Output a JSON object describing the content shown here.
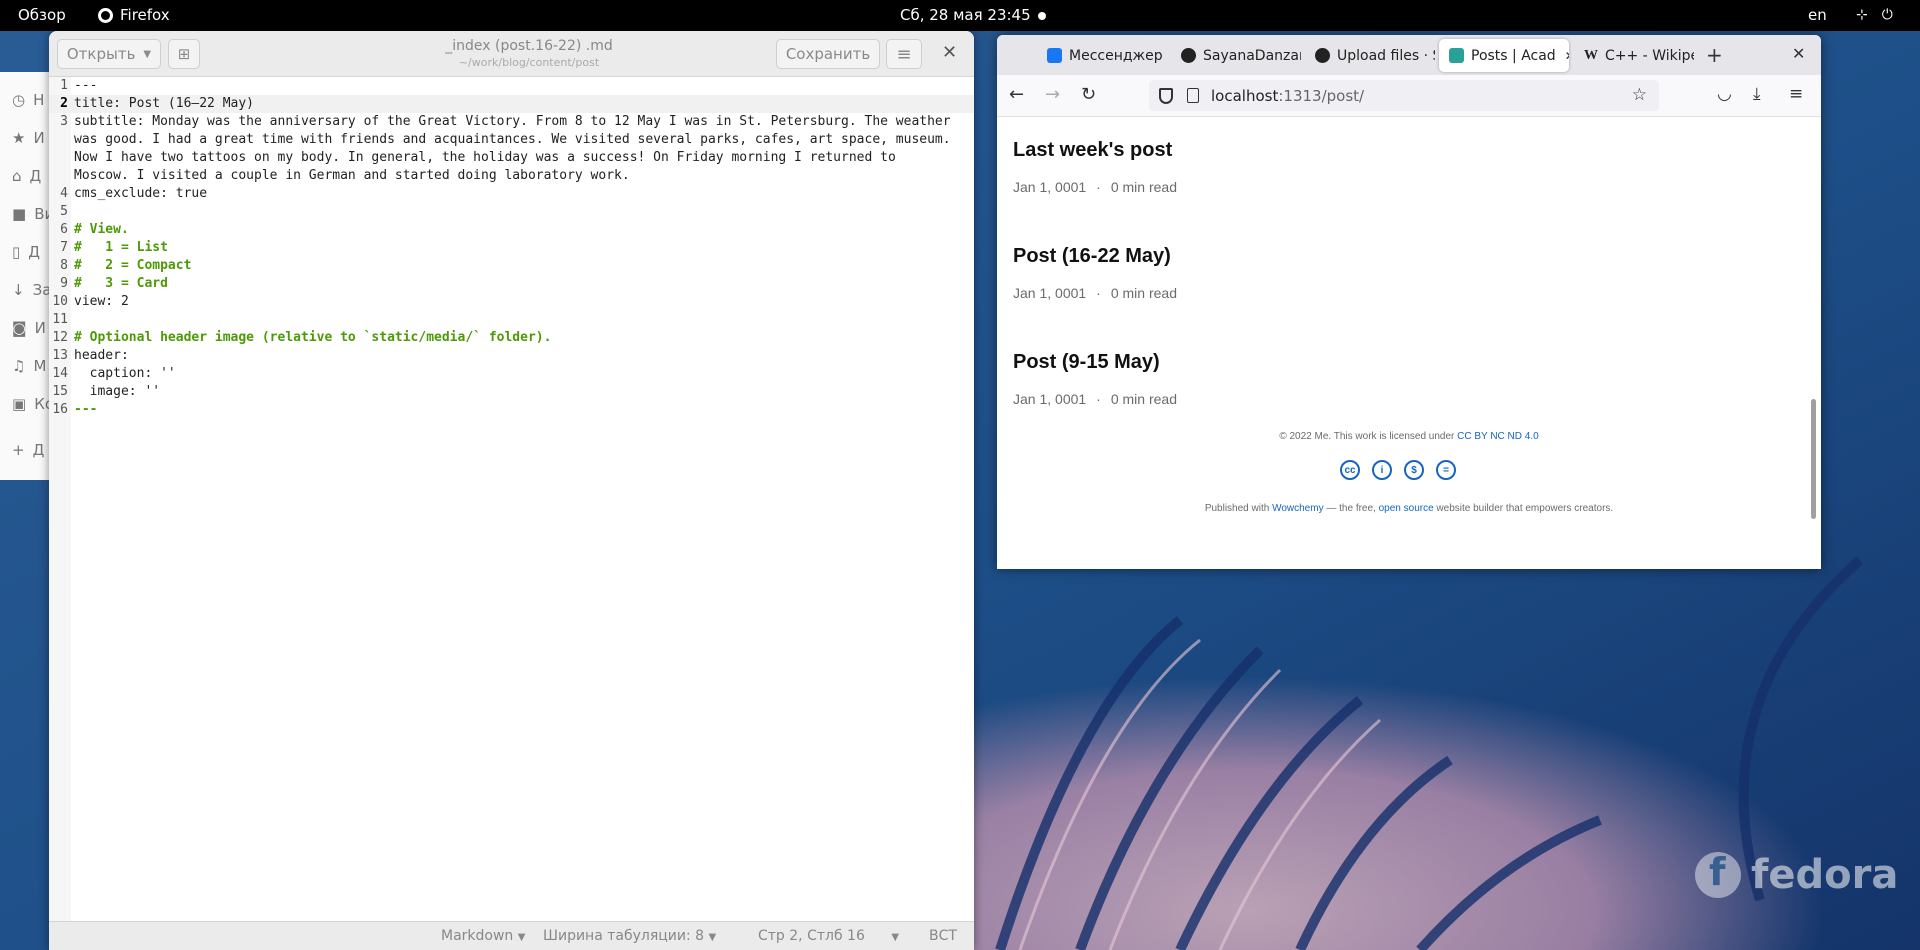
{
  "topbar": {
    "activities": "Обзор",
    "app": "Firefox",
    "clock": "Сб, 28 мая  23:45",
    "lang": "en"
  },
  "background_window": {
    "items": [
      "Н",
      "И",
      "Д",
      "Ви",
      "Д",
      "За",
      "И",
      "М",
      "Ко",
      "Д"
    ]
  },
  "editor": {
    "open_label": "Открыть",
    "title": "_index (post.16-22) .md",
    "subtitle": "~/work/blog/content/post",
    "save_label": "Сохранить",
    "lines": [
      {
        "n": "1",
        "text": "---"
      },
      {
        "n": "2",
        "text": "title: Post (16–22 May)"
      },
      {
        "n": "3",
        "text": "subtitle: Monday was the anniversary of the Great Victory. From 8 to 12 May I was in St. Petersburg. The weather"
      },
      {
        "n": "",
        "text": "was good. I had a great time with friends and acquaintances. We visited several parks, cafes, art space, museum."
      },
      {
        "n": "",
        "text": "Now I have two tattoos on my body. In general, the holiday was a success! On Friday morning I returned to"
      },
      {
        "n": "",
        "text": "Moscow. I visited a couple in German and started doing laboratory work."
      },
      {
        "n": "4",
        "text": "cms_exclude: true"
      },
      {
        "n": "5",
        "text": ""
      },
      {
        "n": "6",
        "text": "# View."
      },
      {
        "n": "7",
        "text": "#   1 = List"
      },
      {
        "n": "8",
        "text": "#   2 = Compact"
      },
      {
        "n": "9",
        "text": "#   3 = Card"
      },
      {
        "n": "10",
        "text": "view: 2"
      },
      {
        "n": "11",
        "text": ""
      },
      {
        "n": "12",
        "text": "# Optional header image (relative to `static/media/` folder)."
      },
      {
        "n": "13",
        "text": "header:"
      },
      {
        "n": "14",
        "text": "  caption: ''"
      },
      {
        "n": "15",
        "text": "  image: ''"
      },
      {
        "n": "16",
        "text": "---"
      }
    ],
    "status": {
      "language": "Markdown",
      "tab_width": "Ширина табуляции: 8",
      "position": "Стр 2, Стлб 16",
      "mode": "ВСТ"
    }
  },
  "browser": {
    "tabs": [
      {
        "label": "Мессенджер",
        "icon": "messenger-icon",
        "color": "#1877f2"
      },
      {
        "label": "SayanaDanzar",
        "icon": "github-icon",
        "color": "#222222"
      },
      {
        "label": "Upload files · S",
        "icon": "github-icon",
        "color": "#222222"
      },
      {
        "label": "Posts | Acad",
        "icon": "academic-icon",
        "color": "#2aa198"
      },
      {
        "label": "C++ - Wikiped",
        "icon": "wikipedia-icon",
        "color": "#222222"
      }
    ],
    "url_host": "localhost",
    "url_path": ":1313/post/",
    "posts": [
      {
        "title": "Last week's post",
        "date": "Jan 1, 0001",
        "read": "0 min read"
      },
      {
        "title": "Post (16-22 May)",
        "date": "Jan 1, 0001",
        "read": "0 min read"
      },
      {
        "title": "Post (9-15 May)",
        "date": "Jan 1, 0001",
        "read": "0 min read"
      }
    ],
    "footer": {
      "copyright": "© 2022 Me. This work is licensed under ",
      "license": "CC BY NC ND 4.0",
      "published_prefix": "Published with ",
      "wowchemy": "Wowchemy",
      "middle": " — the free, ",
      "open_source": "open source",
      "suffix": " website builder that empowers creators."
    }
  },
  "desktop": {
    "brand": "fedora"
  }
}
